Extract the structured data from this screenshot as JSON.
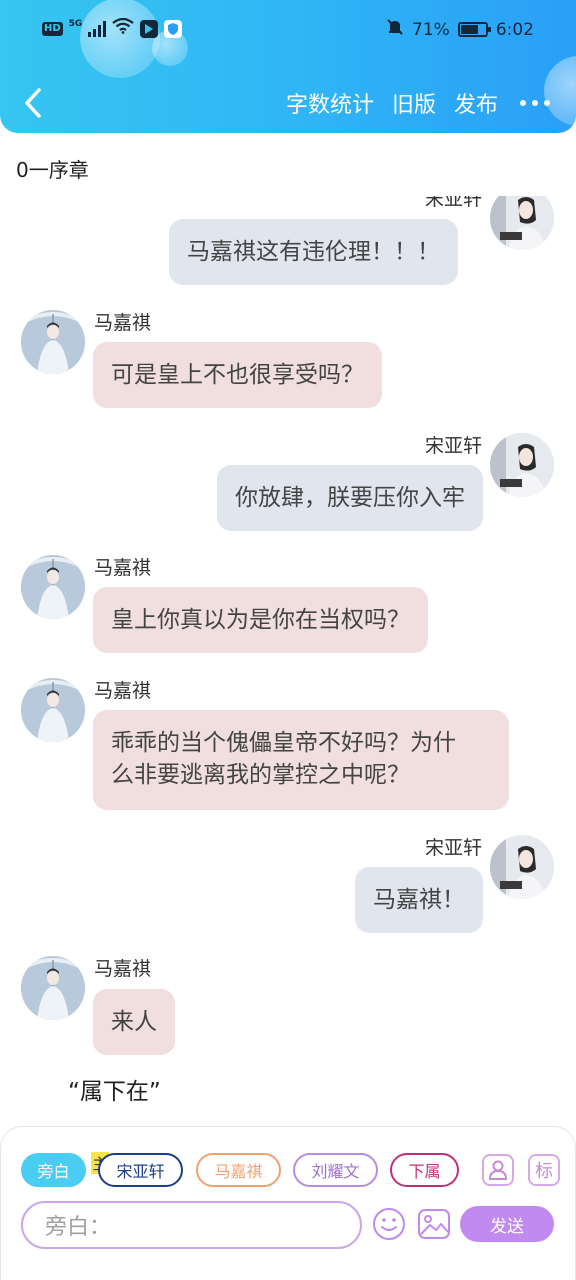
{
  "status_bar": {
    "network": "HD",
    "signal_type": "5G",
    "battery_percent": "71%",
    "battery_level": 0.71,
    "time": "6:02"
  },
  "header": {
    "actions": [
      "字数统计",
      "旧版",
      "发布"
    ]
  },
  "chapter": {
    "title": "0一序章"
  },
  "messages": [
    {
      "side": "right",
      "speaker": "宋亚轩",
      "text": "马嘉祺这有违伦理！！！"
    },
    {
      "side": "left",
      "speaker": "马嘉祺",
      "text": "可是皇上不也很享受吗？"
    },
    {
      "side": "right",
      "speaker": "宋亚轩",
      "text": "你放肆，朕要压你入牢"
    },
    {
      "side": "left",
      "speaker": "马嘉祺",
      "text": "皇上你真以为是你在当权吗？"
    },
    {
      "side": "left",
      "speaker": "马嘉祺",
      "text_lines": [
        "乖乖的当个傀儡皇帝不好吗？为什",
        "么非要逃离我的掌控之中呢？"
      ]
    },
    {
      "side": "right",
      "speaker": "宋亚轩",
      "text": "马嘉祺！"
    },
    {
      "side": "left",
      "speaker": "马嘉祺",
      "text": "来人"
    }
  ],
  "narration": "“属下在”",
  "composer": {
    "roles": [
      "旁白",
      "宋亚轩",
      "马嘉祺",
      "刘耀文",
      "下属"
    ],
    "host_tag": "主",
    "marker_icon_label": "标",
    "input_placeholder": "旁白：",
    "send_label": "发送",
    "colors": {
      "active": "#49cdf2",
      "song": "#1f3c8a",
      "ma": "#f0a070",
      "liu": "#b98be0",
      "xiashu": "#c0307a",
      "send": "#c08af0"
    }
  }
}
